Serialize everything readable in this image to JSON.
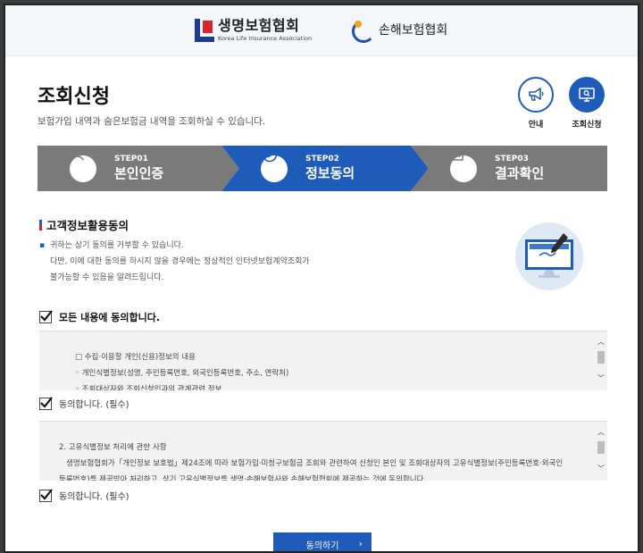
{
  "header": {
    "logo_life_ko": "생명보험협회",
    "logo_life_en": "Korea Life Insurance Association",
    "logo_nonlife_ko": "손해보험협회"
  },
  "page": {
    "title": "조회신청",
    "subtitle": "보험가입 내역과 숨은보험금 내역을 조회하실 수 있습니다.",
    "guide_label": "안내",
    "query_label": "조회신청"
  },
  "steps": [
    {
      "num": "STEP01",
      "name": "본인인증",
      "state": "done",
      "color": "#7a7a7a"
    },
    {
      "num": "STEP02",
      "name": "정보동의",
      "state": "active",
      "color": "#1f5bb8"
    },
    {
      "num": "STEP03",
      "name": "결과확인",
      "state": "pending",
      "color": "#7a7a7a"
    }
  ],
  "consent": {
    "section_title": "고객정보활용동의",
    "note_lines": [
      "귀하는 상기 동의를 거부할 수 있습니다.",
      "다만, 이에 대한 동의를 하시지 않을 경우에는 정상적인 인터넷보험계약조회가",
      "불가능할 수 있음을 알려드립니다."
    ],
    "agree_all_label": "모든 내용에 동의합니다.",
    "agree_all_checked": true,
    "terms1_lines": [
      "□ 수집·이용할 개인(신용)정보의 내용",
      "◦ 개인식별정보(성명, 주민등록번호, 외국인등록번호, 주소, 연락처)",
      "◦ 조회대상자와 조회신청인과의 관계관련 정보"
    ],
    "agree1_label": "동의합니다. (필수)",
    "agree1_checked": true,
    "terms2_lines": [
      "2. 고유식별정보 처리에 관한 사항",
      "생명보험협회가「개인정보 보호법」제24조에 따라 보험가입·미청구보험금 조회와 관련하여 신청인 본인 및 조회대상자의 고유식별정보(주민등록번호·외국인",
      "등록번호)를 제공받아 처리하고, 상기 고유식별정보를 생명·손해보험사와 손해보험협회에 제공하는 것에 동의합니다."
    ],
    "agree2_label": "동의합니다. (필수)",
    "agree2_checked": true,
    "submit_label": "동의하기"
  },
  "colors": {
    "accent": "#1f5bb8",
    "step_inactive": "#7a7a7a",
    "brand_red": "#d8262f"
  }
}
